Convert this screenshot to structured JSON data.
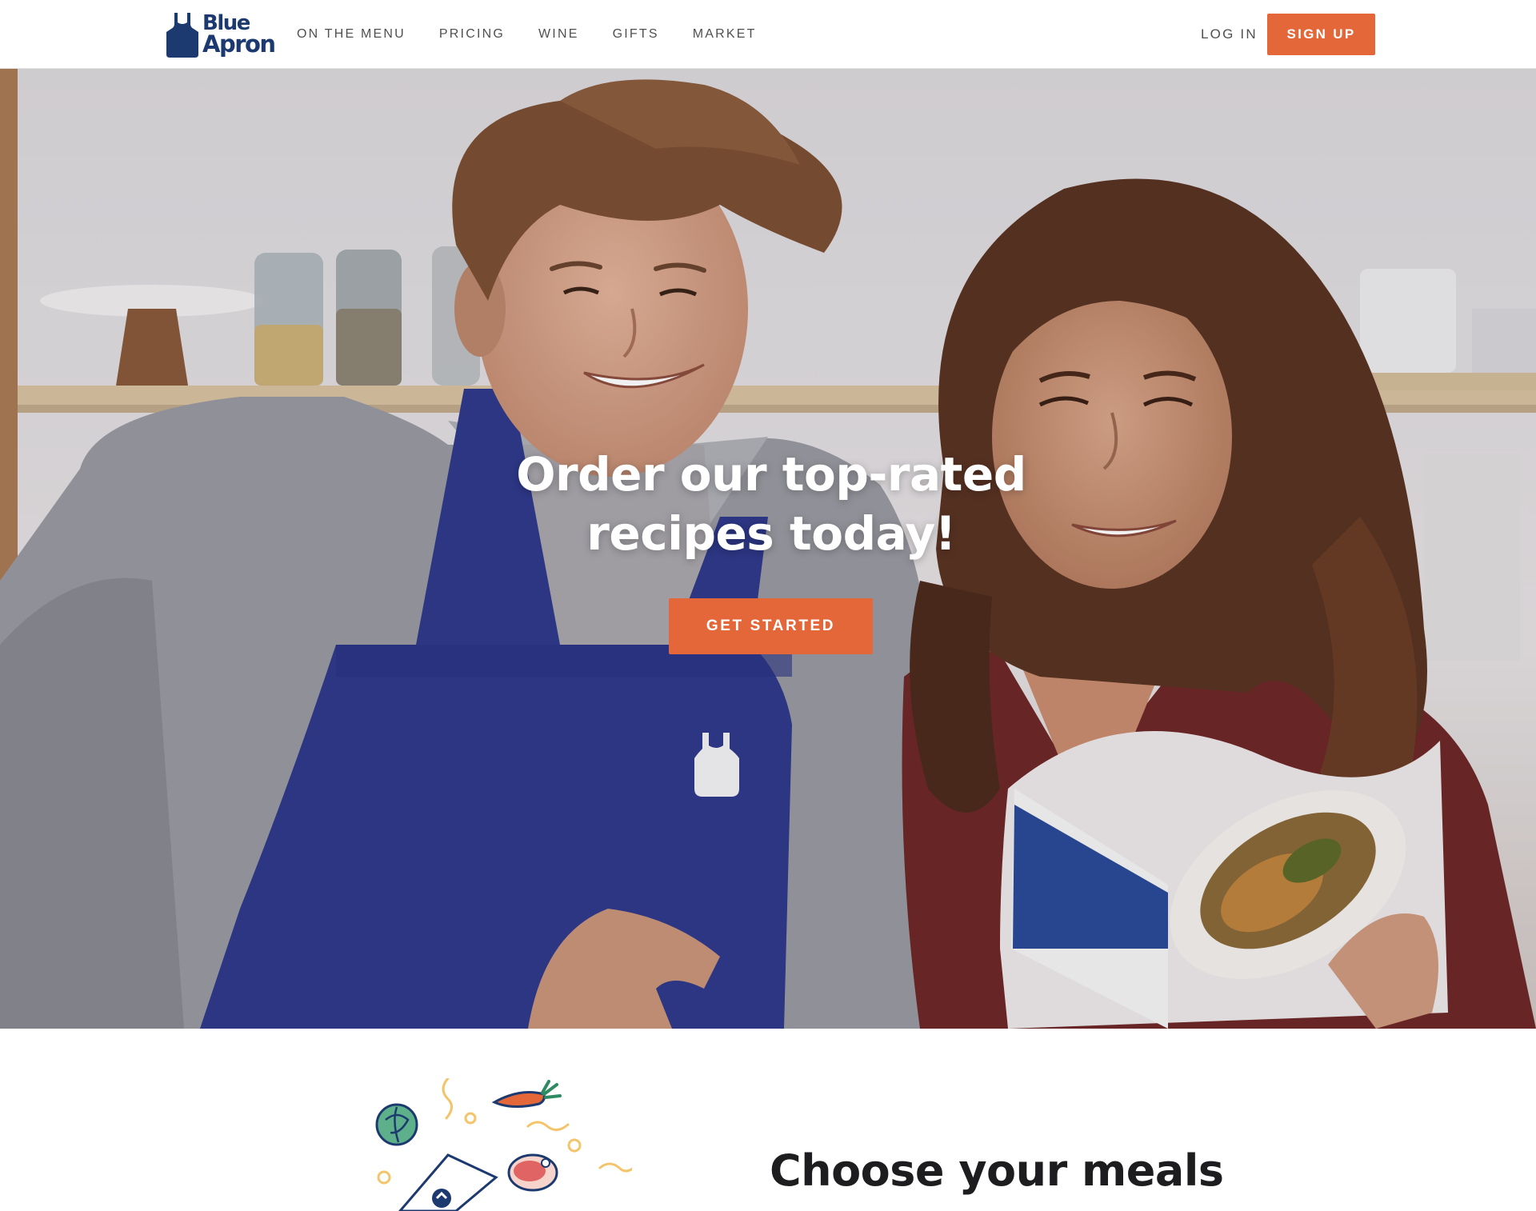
{
  "brand": {
    "line1": "Blue",
    "line2": "Apron"
  },
  "nav": {
    "items": [
      "ON THE MENU",
      "PRICING",
      "WINE",
      "GIFTS",
      "MARKET"
    ],
    "login_label": "LOG IN",
    "signup_label": "SIGN UP"
  },
  "hero": {
    "title_line1": "Order our top-rated",
    "title_line2": "recipes today!",
    "cta_label": "GET STARTED"
  },
  "section": {
    "title": "Choose your meals"
  },
  "colors": {
    "brand_blue": "#1c3a6f",
    "accent_orange": "#e4673a",
    "apron_blue": "#2f3a8c"
  },
  "icons": [
    "apron-logo-icon",
    "cabbage-icon",
    "carrot-icon",
    "steak-icon",
    "box-icon"
  ]
}
